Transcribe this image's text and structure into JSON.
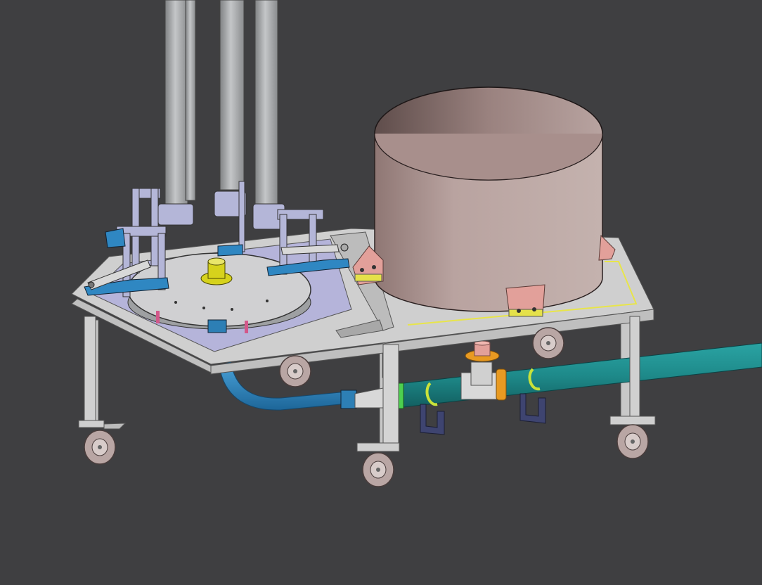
{
  "viewport": {
    "kind": "3d-cad-viewport",
    "background_color": "#3f3f41"
  },
  "model": {
    "parts": [
      {
        "name": "vertical-pipes",
        "color": "#a9abad"
      },
      {
        "name": "clamp-brackets",
        "color": "#b4b6d8"
      },
      {
        "name": "rotary-plate",
        "color": "#c9c9cb"
      },
      {
        "name": "center-hub",
        "color": "#d6d21c"
      },
      {
        "name": "support-frame",
        "color": "#c8c8c8"
      },
      {
        "name": "deck-panel",
        "color": "#b5b4da"
      },
      {
        "name": "tank",
        "color": "#b8a09c"
      },
      {
        "name": "mount-brackets",
        "color": "#e2a09a"
      },
      {
        "name": "flex-hose",
        "color": "#2f87c2"
      },
      {
        "name": "teal-pipe",
        "color": "#1e8a8a"
      },
      {
        "name": "tee-flange",
        "color": "#e89a22"
      },
      {
        "name": "pipe-clamps",
        "color": "#c9e23a"
      },
      {
        "name": "pipe-supports",
        "color": "#3e4470"
      },
      {
        "name": "caster-wheels",
        "color": "#b9a6a4"
      }
    ],
    "caster_count": 6
  }
}
